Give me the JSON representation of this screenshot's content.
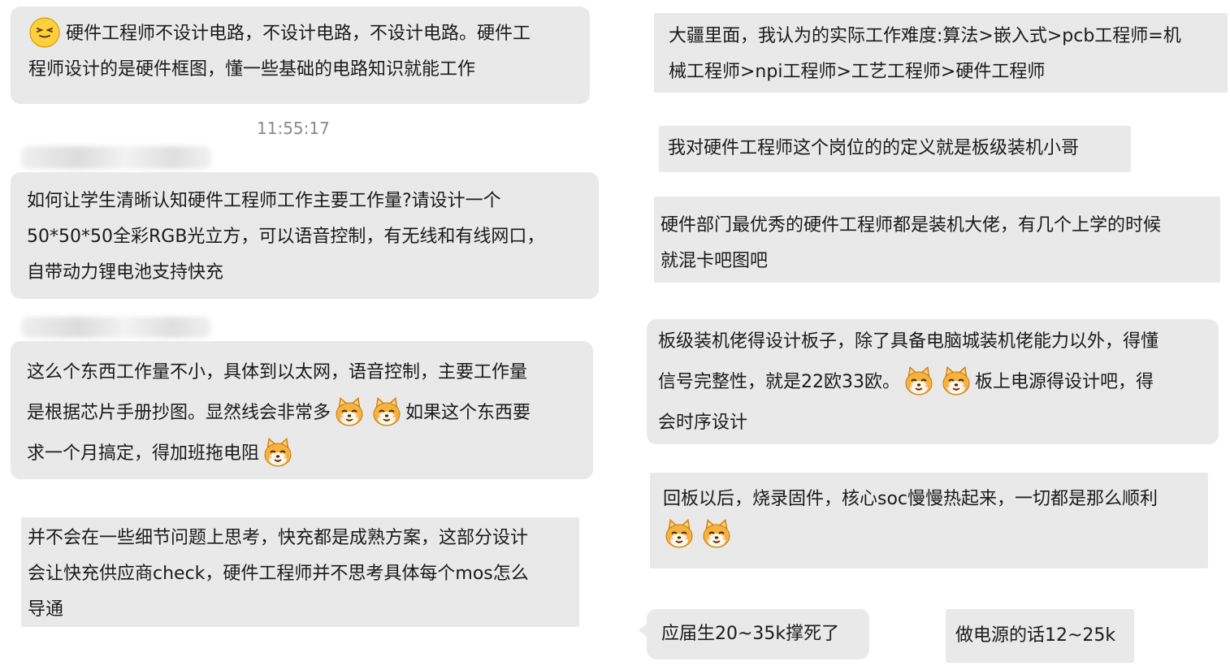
{
  "left": {
    "msg1": {
      "text_a": "硬件工程师不设计电路，不设计电路，不设计电路。硬件工",
      "text_b": "程师设计的是硬件框图，懂一些基础的电路知识就能工作"
    },
    "timestamp": "11:55:17",
    "msg2": {
      "line1": "如何让学生清晰认知硬件工程师工作主要工作量?请设计一个",
      "line2": "50*50*50全彩RGB光立方，可以语音控制，有无线和有线网口，",
      "line3": "自带动力锂电池支持快充"
    },
    "msg3": {
      "line1": "这么个东西工作量不小，具体到以太网，语音控制，主要工作量",
      "line2a": "是根据芯片手册抄图。显然线会非常多",
      "line2b": "如果这个东西要",
      "line3": "求一个月搞定，得加班拖电阻"
    },
    "msg4": {
      "line1": "并不会在一些细节问题上思考，快充都是成熟方案，这部分设计",
      "line2": "会让快充供应商check，硬件工程师并不思考具体每个mos怎么",
      "line3": "导通"
    }
  },
  "right": {
    "msg1": {
      "line1": "大疆里面，我认为的实际工作难度:算法>嵌入式>pcb工程师=机",
      "line2": "械工程师>npi工程师>工艺工程师>硬件工程师"
    },
    "msg2": {
      "line1": "我对硬件工程师这个岗位的的定义就是板级装机小哥"
    },
    "msg3": {
      "line1": "硬件部门最优秀的硬件工程师都是装机大佬，有几个上学的时候",
      "line2": "就混卡吧图吧"
    },
    "msg4": {
      "line1": "板级装机佬得设计板子，除了具备电脑城装机佬能力以外，得懂",
      "line2a": "信号完整性，就是22欧33欧。",
      "line2b": "板上电源得设计吧，得",
      "line3": "会时序设计"
    },
    "msg5": {
      "line1": "回板以后，烧录固件，核心soc慢慢热起来，一切都是那么顺利"
    },
    "msg6": {
      "line1": "应届生20~35k撑死了"
    },
    "msg7": {
      "line1": "做电源的话12~25k"
    }
  },
  "icons": {
    "shiba": "shiba-emoji-icon",
    "grin": "grin-emoji-icon"
  },
  "colors": {
    "bubble": "#e9e9e9",
    "text": "#1a1a1a",
    "timestamp": "#8a8a8a"
  }
}
